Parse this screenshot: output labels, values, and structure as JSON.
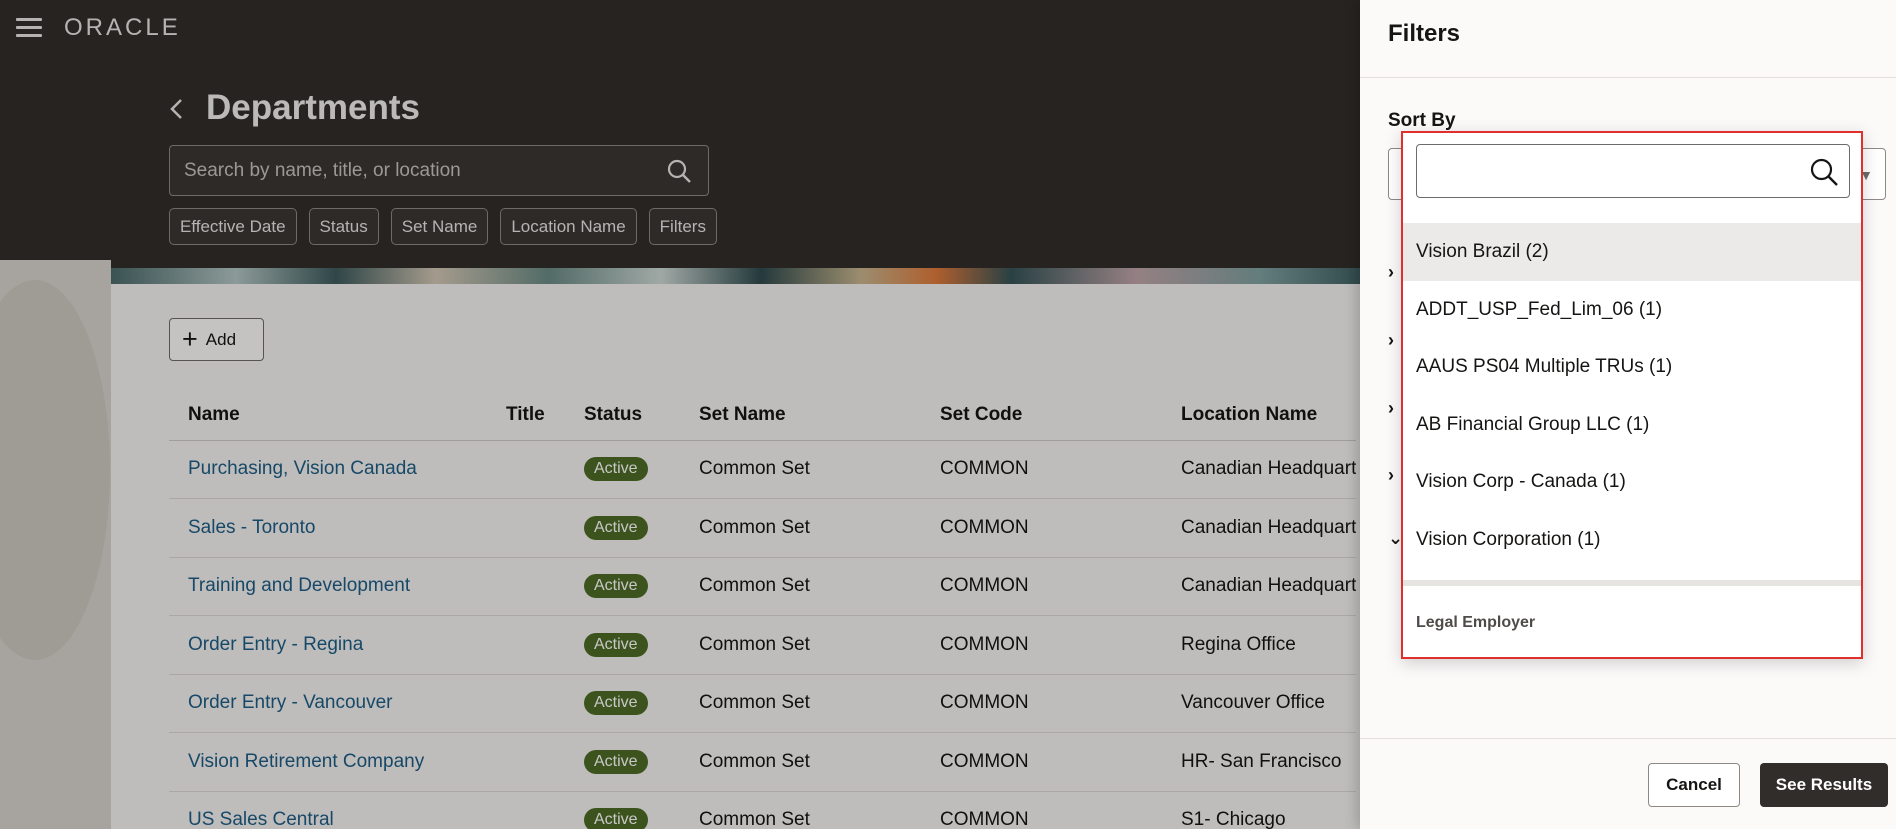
{
  "header": {
    "logo_text": "ORACLE",
    "page_title": "Departments",
    "search_placeholder": "Search by name, title, or location",
    "chips": [
      "Effective Date",
      "Status",
      "Set Name",
      "Location Name",
      "Filters"
    ]
  },
  "content": {
    "add_label": "Add",
    "columns": [
      "Name",
      "Title",
      "Status",
      "Set Name",
      "Set Code",
      "Location Name"
    ],
    "rows": [
      {
        "name": "Purchasing, Vision Canada",
        "title": "",
        "status": "Active",
        "set_name": "Common Set",
        "set_code": "COMMON",
        "location": "Canadian Headquart"
      },
      {
        "name": "Sales - Toronto",
        "title": "",
        "status": "Active",
        "set_name": "Common Set",
        "set_code": "COMMON",
        "location": "Canadian Headquart"
      },
      {
        "name": "Training and Development",
        "title": "",
        "status": "Active",
        "set_name": "Common Set",
        "set_code": "COMMON",
        "location": "Canadian Headquart"
      },
      {
        "name": "Order Entry - Regina",
        "title": "",
        "status": "Active",
        "set_name": "Common Set",
        "set_code": "COMMON",
        "location": "Regina Office"
      },
      {
        "name": "Order Entry - Vancouver",
        "title": "",
        "status": "Active",
        "set_name": "Common Set",
        "set_code": "COMMON",
        "location": "Vancouver Office"
      },
      {
        "name": "Vision Retirement Company",
        "title": "",
        "status": "Active",
        "set_name": "Common Set",
        "set_code": "COMMON",
        "location": "HR- San Francisco"
      },
      {
        "name": "US Sales Central",
        "title": "",
        "status": "Active",
        "set_name": "Common Set",
        "set_code": "COMMON",
        "location": "S1- Chicago"
      }
    ]
  },
  "drawer": {
    "title": "Filters",
    "sort_label": "Sort By",
    "cancel_label": "Cancel",
    "results_label": "See Results"
  },
  "popup": {
    "search_value": "",
    "options": [
      "Vision Brazil (2)",
      "ADDT_USP_Fed_Lim_06 (1)",
      "AAUS PS04 Multiple TRUs (1)",
      "AB Financial Group LLC (1)",
      "Vision Corp - Canada (1)",
      "Vision Corporation (1)"
    ],
    "selected_index": 0,
    "footer_label": "Legal Employer"
  },
  "colors": {
    "header_bg": "#312d2a",
    "active_badge": "#4e6b26",
    "link": "#1e5d84",
    "highlight_border": "#e0302d"
  }
}
